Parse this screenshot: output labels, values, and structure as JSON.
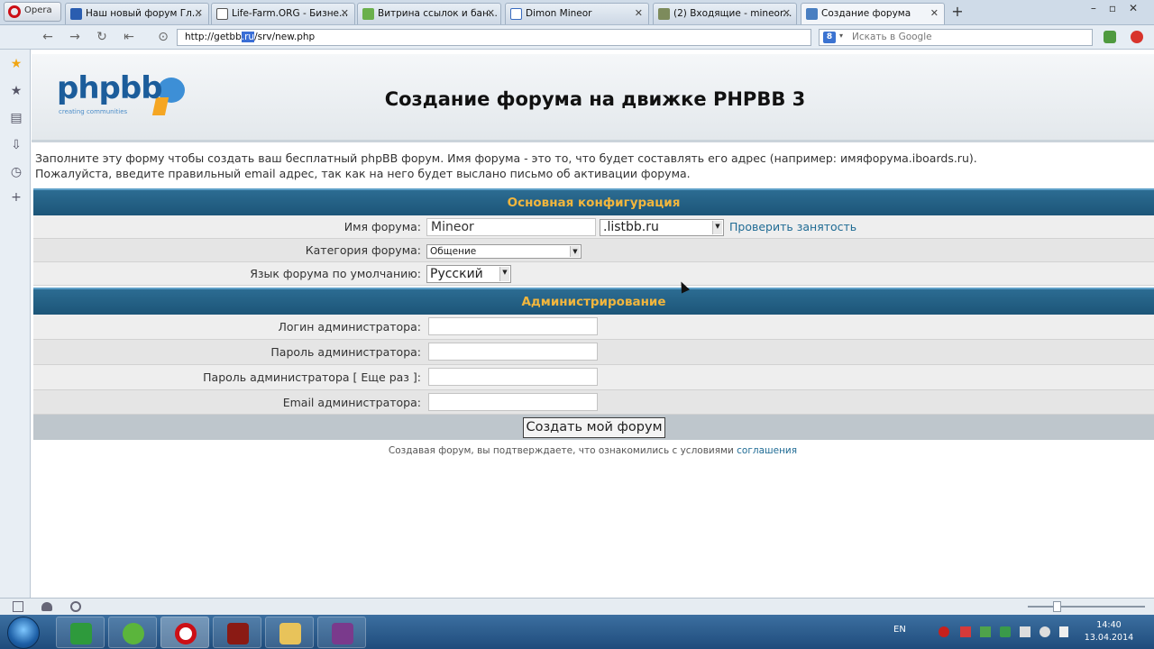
{
  "browser": {
    "menu_label": "Opera",
    "tabs": [
      {
        "title": "Наш новый форум Гл..."
      },
      {
        "title": "Life-Farm.ORG - Бизне..."
      },
      {
        "title": "Витрина ссылок и бан..."
      },
      {
        "title": "Dimon Mineor"
      },
      {
        "title": "(2) Входящие - mineor..."
      },
      {
        "title": "Создание форума"
      }
    ],
    "address_prefix": "http://getbb",
    "address_highlight": ".ru",
    "address_suffix": "/srv/new.php",
    "search_placeholder": "Искать в Google",
    "search_engine_letter": "8"
  },
  "page": {
    "logo_text": "phpbb",
    "logo_sub": "creating communities",
    "title": "Создание форума на движке PHPBB 3",
    "intro_line1": "Заполните эту форму чтобы создать ваш бесплатный phpBB форум. Имя форума - это то, что будет составлять его адрес (например: имяфорума.iboards.ru).",
    "intro_line2": "Пожалуйста, введите правильный email адрес, так как на него будет выслано письмо об активации форума.",
    "section_config": "Основная конфигурация",
    "forum_name_label": "Имя форума:",
    "forum_name_value": "Mineor",
    "domain_value": ".listbb.ru",
    "check_link": "Проверить занятость",
    "category_label": "Категория форума:",
    "category_value": "Общение",
    "language_label": "Язык форума по умолчанию:",
    "language_value": "Русский",
    "section_admin": "Администрирование",
    "admin_login_label": "Логин администратора:",
    "admin_password_label": "Пароль администратора:",
    "admin_password_repeat_label": "Пароль администратора [ Еще раз ]:",
    "admin_email_label": "Email администратора:",
    "submit_label": "Создать мой форум",
    "footer_text": "Создавая форум, вы подтверждаете, что ознакомились с условиями",
    "footer_link": "соглашения"
  },
  "taskbar": {
    "lang": "EN",
    "time": "14:40",
    "date": "13.04.2014"
  },
  "colors": {
    "section_bar": "#1c5578",
    "section_text": "#f2b63d",
    "link": "#1f6b94"
  }
}
